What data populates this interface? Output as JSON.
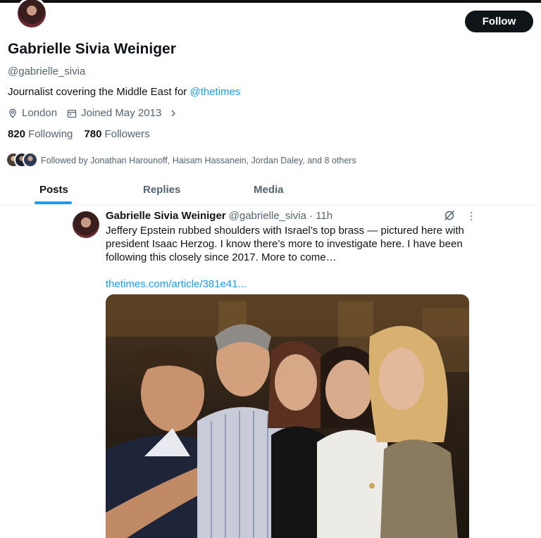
{
  "profile": {
    "name": "Gabrielle Sivia Weiniger",
    "handle": "@gabrielle_sivia",
    "bio_text": "Journalist covering the Middle East for ",
    "bio_mention": "@thetimes",
    "location": "London",
    "joined": "Joined May 2013",
    "following_count": "820",
    "following_label": "Following",
    "followers_count": "780",
    "followers_label": "Followers",
    "followed_by": "Followed by Jonathan Harounoff, Haisam Hassanein, Jordan Daley, and 8 others",
    "follow_label": "Follow"
  },
  "tabs": [
    {
      "label": "Posts",
      "active": true
    },
    {
      "label": "Replies",
      "active": false
    },
    {
      "label": "Media",
      "active": false
    }
  ],
  "post": {
    "author": "Gabrielle Sivia Weiniger",
    "handle_time": "@gabrielle_sivia · 11h",
    "text": "Jeffery Epstein rubbed shoulders with Israel’s top brass — pictured here with president Isaac Herzog. I know there’s more to investigate here. I have been following this closely since 2017. More to come…",
    "link": "thetimes.com/article/381e41..."
  },
  "colors": {
    "accent": "#1d9bf0",
    "text_primary": "#0f1419",
    "text_secondary": "#536471",
    "follow_button_bg": "#0f1419"
  },
  "icons": {
    "location": "location-pin-icon",
    "calendar": "calendar-icon",
    "chevron": "chevron-right-icon",
    "grok": "grok-icon",
    "more": "more-icon"
  }
}
